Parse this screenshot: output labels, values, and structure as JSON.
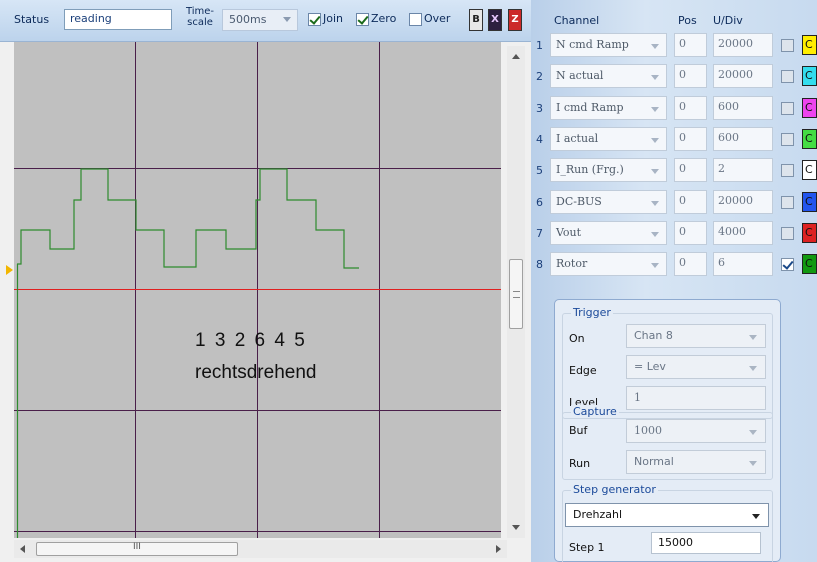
{
  "toolbar": {
    "status_label": "Status",
    "status_value": "reading",
    "timescale_label_line1": "Time-",
    "timescale_label_line2": "scale",
    "timescale_value": "500ms",
    "join_label": "Join",
    "join_checked": true,
    "zero_label": "Zero",
    "zero_checked": true,
    "over_label": "Over",
    "over_checked": false,
    "btn_b": "B",
    "btn_x": "X",
    "btn_z": "Z"
  },
  "plot": {
    "annotation_steps": "1 3 2 6 4 5",
    "annotation_direction": "rechtsdrehend",
    "trace_color": "#2e8b2e",
    "reference_line_color": "#e02020",
    "grid_color": "#4a1f4a"
  },
  "scrollbar": {
    "h_grip": "III"
  },
  "channels": {
    "header_channel": "Channel",
    "header_pos": "Pos",
    "header_udiv": "U/Div",
    "rows": [
      {
        "num": "1",
        "name": "N cmd Ramp",
        "pos": "0",
        "udiv": "20000",
        "checked": false,
        "color": "#ffee00",
        "color_letter": "C"
      },
      {
        "num": "2",
        "name": "N actual",
        "pos": "0",
        "udiv": "20000",
        "checked": false,
        "color": "#33ddee",
        "color_letter": "C"
      },
      {
        "num": "3",
        "name": "I cmd Ramp",
        "pos": "0",
        "udiv": "600",
        "checked": false,
        "color": "#ee44ee",
        "color_letter": "C"
      },
      {
        "num": "4",
        "name": "I actual",
        "pos": "0",
        "udiv": "600",
        "checked": false,
        "color": "#44dd44",
        "color_letter": "C"
      },
      {
        "num": "5",
        "name": "I_Run (Frg.)",
        "pos": "0",
        "udiv": "2",
        "checked": false,
        "color": "#ffffff",
        "color_letter": "C"
      },
      {
        "num": "6",
        "name": "DC-BUS",
        "pos": "0",
        "udiv": "20000",
        "checked": false,
        "color": "#2255ee",
        "color_letter": "C"
      },
      {
        "num": "7",
        "name": "Vout",
        "pos": "0",
        "udiv": "4000",
        "checked": false,
        "color": "#dd2222",
        "color_letter": "C"
      },
      {
        "num": "8",
        "name": "Rotor",
        "pos": "0",
        "udiv": "6",
        "checked": true,
        "color": "#119911",
        "color_letter": "C"
      }
    ]
  },
  "trigger": {
    "title": "Trigger",
    "on_label": "On",
    "on_value": "Chan 8",
    "edge_label": "Edge",
    "edge_value": "= Lev",
    "level_label": "Level",
    "level_value": "1"
  },
  "capture": {
    "title": "Capture",
    "buf_label": "Buf",
    "buf_value": "1000",
    "run_label": "Run",
    "run_value": "Normal"
  },
  "step_generator": {
    "title": "Step generator",
    "mode_value": "Drehzahl",
    "step1_label": "Step 1",
    "step1_value": "15000"
  }
}
